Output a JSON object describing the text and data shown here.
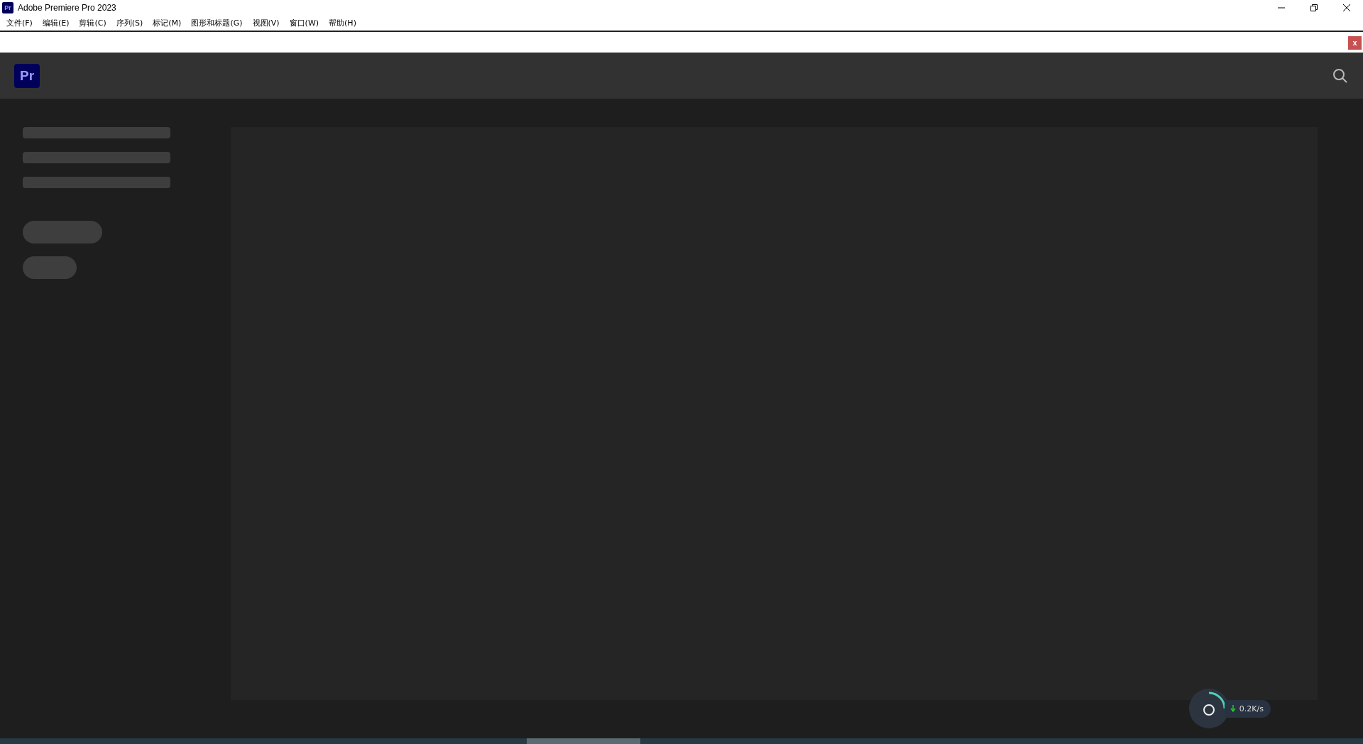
{
  "window": {
    "icon_text": "Pr",
    "title": "Adobe Premiere Pro 2023"
  },
  "menu": [
    "文件(F)",
    "编辑(E)",
    "剪辑(C)",
    "序列(S)",
    "标记(M)",
    "图形和标题(G)",
    "视图(V)",
    "窗口(W)",
    "帮助(H)"
  ],
  "notification_bar": {
    "close_label": "x"
  },
  "header": {
    "logo_text": "Pr"
  },
  "network_widget": {
    "speed": "0.2K/s"
  }
}
